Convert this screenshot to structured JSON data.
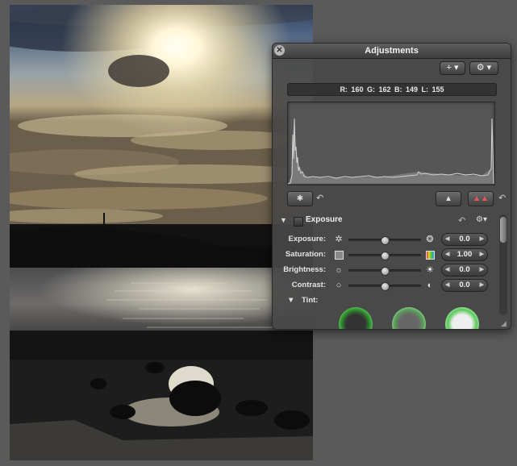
{
  "hud": {
    "title": "Adjustments",
    "close_glyph": "✕",
    "add_button": "+ ▾",
    "gear_button": "⚙ ▾",
    "readout": {
      "r": "R: 160",
      "g": "G: 162",
      "b": "B: 149",
      "l": "L: 155"
    },
    "undo_glyph": "↶",
    "section": {
      "title": "Exposure",
      "gear_glyph": "⚙▾"
    },
    "rows": [
      {
        "label": "Exposure:",
        "value": "0.0",
        "icon_left": "aperture-icon",
        "icon_right": "aperture-bright-icon",
        "level": 0.5
      },
      {
        "label": "Saturation:",
        "value": "1.00",
        "icon_left": "desaturated-swatch-icon",
        "icon_right": "saturated-swatch-icon",
        "level": 0.5
      },
      {
        "label": "Brightness:",
        "value": "0.0",
        "icon_left": "sun-dim-icon",
        "icon_right": "sun-bright-icon",
        "level": 0.5
      },
      {
        "label": "Contrast:",
        "value": "0.0",
        "icon_left": "circle-outline-icon",
        "icon_right": "half-circle-icon",
        "level": 0.5
      }
    ],
    "tint_label": "Tint:",
    "colors": {
      "accent": "#2f8f2f",
      "panel": "#484848"
    }
  }
}
